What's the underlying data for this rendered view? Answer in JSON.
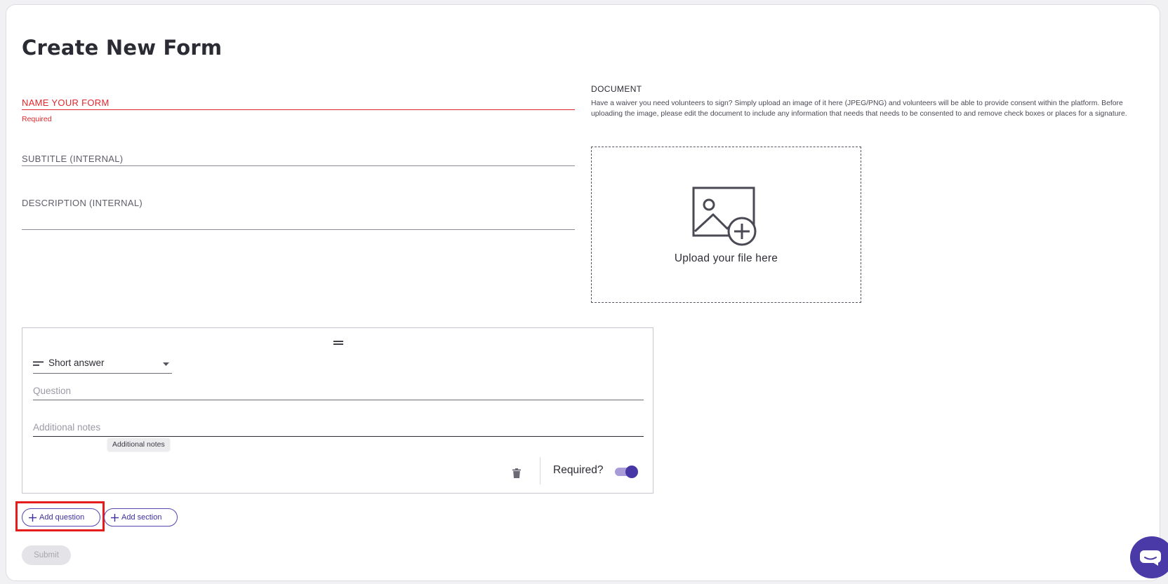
{
  "page": {
    "title": "Create New Form"
  },
  "form": {
    "name_label": "NAME YOUR FORM",
    "name_error": "Required",
    "subtitle_label": "SUBTITLE (INTERNAL)",
    "description_label": "DESCRIPTION (INTERNAL)"
  },
  "document": {
    "title": "DOCUMENT",
    "help_text": "Have a waiver you need volunteers to sign? Simply upload an image of it here (JPEG/PNG) and volunteers will be able to provide consent within the platform. Before uploading the image, please edit the document to include any information that needs that needs to be consented to and remove check boxes or places for a signature.",
    "upload_text": "Upload your file here",
    "upload_icon": "image-add-icon"
  },
  "question": {
    "type_selected": "Short answer",
    "question_placeholder": "Question",
    "notes_placeholder": "Additional notes",
    "notes_tooltip": "Additional notes",
    "required_label": "Required?",
    "required_on": true
  },
  "actions": {
    "add_question": "Add question",
    "add_section": "Add section",
    "submit": "Submit"
  },
  "colors": {
    "accent": "#4a3aa8",
    "error": "#e0282c",
    "highlight": "#e61b1b"
  }
}
